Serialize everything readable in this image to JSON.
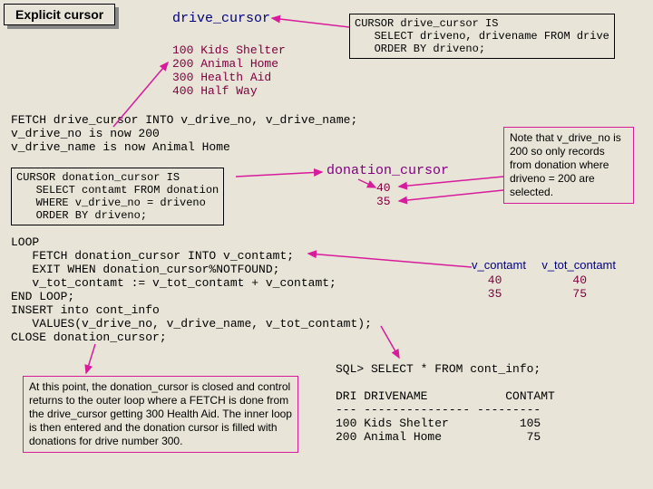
{
  "title": "Explicit cursor",
  "drive_cursor": {
    "heading": "drive_cursor",
    "rows": "100 Kids Shelter\n200 Animal Home\n300 Health Aid\n400 Half Way",
    "def": "CURSOR drive_cursor IS\n   SELECT driveno, drivename FROM drive\n   ORDER BY driveno;"
  },
  "fetch_block": "FETCH drive_cursor INTO v_drive_no, v_drive_name;\nv_drive_no is now 200\nv_drive_name is now Animal Home",
  "donation_def": "CURSOR donation_cursor IS\n   SELECT contamt FROM donation\n   WHERE v_drive_no = driveno\n   ORDER BY driveno;",
  "donation_cursor": {
    "heading": "donation_cursor",
    "vals": "40\n35"
  },
  "note_box": "Note that v_drive_no is 200 so only records from donation where driveno = 200 are selected.",
  "loop_block": "LOOP\n   FETCH donation_cursor INTO v_contamt;\n   EXIT WHEN donation_cursor%NOTFOUND;\n   v_tot_contamt := v_tot_contamt + v_contamt;\nEND LOOP;\nINSERT into cont_info\n   VALUES(v_drive_no, v_drive_name, v_tot_contamt);\nCLOSE donation_cursor;",
  "contamt_table": {
    "h1": "v_contamt",
    "h2": "v_tot_contamt",
    "rows": " 40          40\n 35          75"
  },
  "explain_box": "At this point, the donation_cursor is closed and control returns to the outer loop where a FETCH is done from the drive_cursor getting 300 Health Aid.  The inner loop is then entered and the donation cursor is filled with donations for drive number 300.",
  "sql_out": "SQL> SELECT * FROM cont_info;\n\nDRI DRIVENAME           CONTAMT\n--- --------------- ---------\n100 Kids Shelter          105\n200 Animal Home            75"
}
